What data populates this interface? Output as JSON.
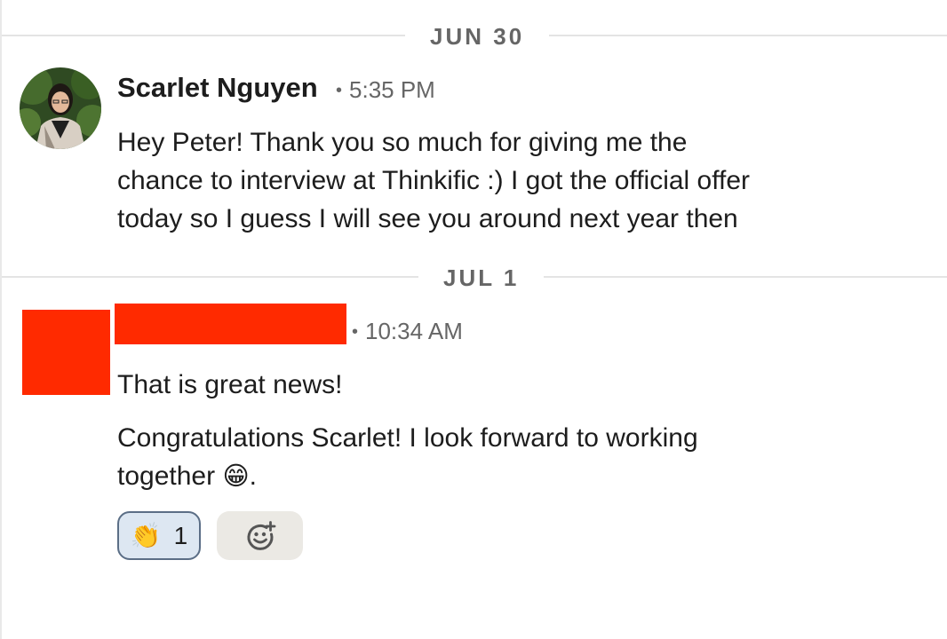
{
  "conversation": {
    "groups": [
      {
        "date": "JUN 30",
        "message": {
          "sender": "Scarlet Nguyen",
          "time": "5:35 PM",
          "lines": [
            "Hey Peter! Thank you so much for giving me the",
            "chance to interview at Thinkific :) I got the official offer",
            "today so I guess I will see you around next year then"
          ]
        }
      },
      {
        "date": "JUL 1",
        "message": {
          "sender": "",
          "time": "10:34 AM",
          "line1": "That is great news!",
          "line2": "Congratulations Scarlet! I look forward to working",
          "line3_text": "together",
          "line3_emoji": "😁",
          "line3_end": ".",
          "reactions": [
            {
              "emoji": "👏",
              "count": "1"
            }
          ]
        }
      }
    ]
  },
  "separator_dot": "•",
  "colors": {
    "redaction": "#ff2a00",
    "reaction_bg": "#dde7f2",
    "reaction_border": "#5b6e86",
    "add_reaction_bg": "#ebe9e4",
    "divider": "#e4e4e4",
    "meta_text": "#666666"
  },
  "icons": {
    "add_reaction": "smiley-plus-icon"
  }
}
